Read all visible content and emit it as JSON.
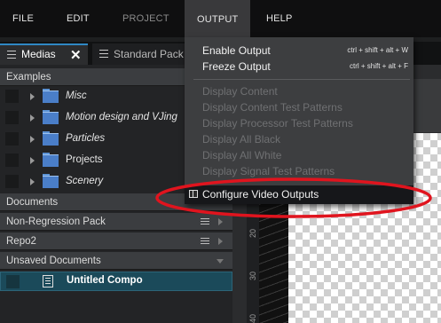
{
  "menubar": {
    "items": [
      {
        "label": "FILE",
        "state": "normal"
      },
      {
        "label": "EDIT",
        "state": "normal"
      },
      {
        "label": "PROJECT",
        "state": "disabled"
      },
      {
        "label": "OUTPUT",
        "state": "open"
      },
      {
        "label": "HELP",
        "state": "normal"
      }
    ]
  },
  "tabs": [
    {
      "label": "Medias",
      "active": true,
      "close_glyph": "✕"
    },
    {
      "label": "Standard Pack",
      "active": false
    }
  ],
  "left_panel": {
    "examples_header": "Examples",
    "examples": [
      {
        "label": "Misc",
        "italic": true
      },
      {
        "label": "Motion design and VJing",
        "italic": true
      },
      {
        "label": "Particles",
        "italic": true
      },
      {
        "label": "Projects",
        "italic": false
      },
      {
        "label": "Scenery",
        "italic": true
      }
    ],
    "sections": [
      {
        "label": "Documents"
      },
      {
        "label": "Non-Regression Pack"
      },
      {
        "label": "Repo2"
      },
      {
        "label": "Unsaved Documents"
      }
    ],
    "document": {
      "label": "Untitled Compo",
      "icon": "document-icon"
    }
  },
  "ruler": {
    "labels": [
      "20",
      "30",
      "40"
    ]
  },
  "output_menu": {
    "items": [
      {
        "label": "Enable Output",
        "shortcut": "ctrl + shift + alt + W",
        "enabled": true
      },
      {
        "label": "Freeze Output",
        "shortcut": "ctrl + shift + alt + F",
        "enabled": true
      },
      {
        "label": "Display Content",
        "enabled": false
      },
      {
        "label": "Display Content Test Patterns",
        "enabled": false
      },
      {
        "label": "Display Processor Test Patterns",
        "enabled": false
      },
      {
        "label": "Display All Black",
        "enabled": false
      },
      {
        "label": "Display All White",
        "enabled": false
      },
      {
        "label": "Display Signal Test Patterns",
        "enabled": false
      },
      {
        "label": "Configure Video Outputs",
        "enabled": true,
        "highlighted": true,
        "icon": "monitor-icon"
      }
    ]
  },
  "annotation": {
    "color": "#e0141e",
    "shape": "ellipse",
    "target": "Configure Video Outputs"
  },
  "colors": {
    "accent": "#2f88c4",
    "selection": "#1b4a5a",
    "folder": "#4a7ec8"
  }
}
